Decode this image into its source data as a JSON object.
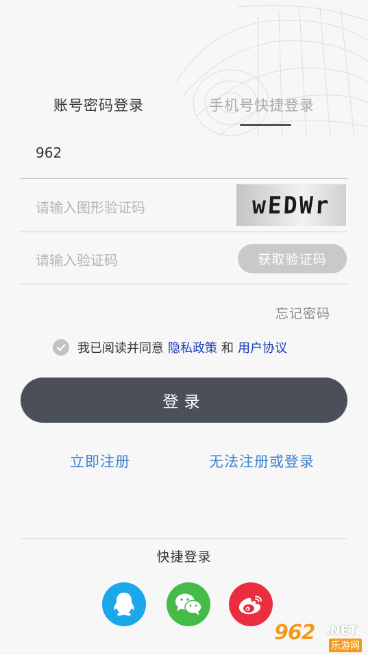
{
  "tabs": {
    "account_login": "账号密码登录",
    "phone_login": "手机号快捷登录"
  },
  "form": {
    "account_value": "962",
    "captcha_placeholder": "请输入图形验证码",
    "captcha_image_text": "wEDWr",
    "code_placeholder": "请输入验证码",
    "get_code_label": "获取验证码",
    "forgot_password": "忘记密码"
  },
  "agreement": {
    "prefix": "我已阅读并同意",
    "privacy_policy": "隐私政策",
    "conjunction": "和",
    "user_agreement": "用户协议"
  },
  "actions": {
    "login": "登录",
    "register": "立即注册",
    "cannot_login": "无法注册或登录"
  },
  "quick_login": {
    "title": "快捷登录",
    "providers": [
      {
        "icon": "qq-icon",
        "color": "#1aa8ea"
      },
      {
        "icon": "wechat-icon",
        "color": "#45bb4a"
      },
      {
        "icon": "weibo-icon",
        "color": "#ea2e3f"
      }
    ]
  },
  "watermark": {
    "brand": "962",
    "domain": ".NET",
    "sub": "乐游网"
  },
  "colors": {
    "primary_button": "#4a4f5a",
    "link_blue": "#3d82cf",
    "policy_link": "#1a3bb5"
  }
}
